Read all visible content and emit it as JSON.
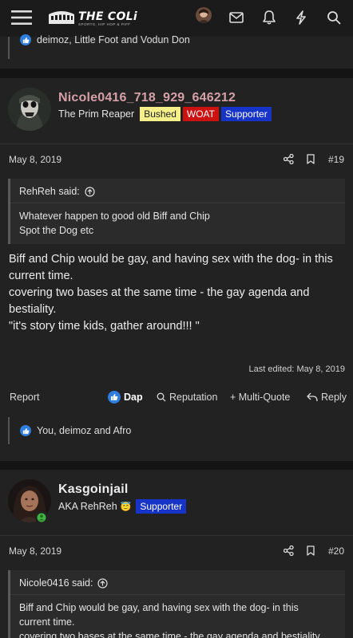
{
  "topbar": {
    "logo_text": "THE COLi",
    "logo_sub": "SPORTS, HIP HOP & PIFF",
    "icons": [
      "menu-icon",
      "avatar",
      "mail-icon",
      "bell-icon",
      "lightning-icon",
      "search-icon"
    ]
  },
  "top_reactions": {
    "text": "deimoz, Little Foot and Vodun Don"
  },
  "post19": {
    "username": "Nicole0416_718_929_646212",
    "user_title": "The Prim Reaper",
    "badges": [
      {
        "label": "Bushed",
        "bg": "#f5f08a",
        "fg": "#1a1a1a"
      },
      {
        "label": "WOAT",
        "bg": "#cc1111",
        "fg": "#ffffff"
      },
      {
        "label": "Supporter",
        "bg": "#1734c8",
        "fg": "#ffffff"
      }
    ],
    "date": "May 8, 2019",
    "post_number": "#19",
    "quote_author": "RehReh said:",
    "quote_lines": [
      "Whatever happen to good old Biff and Chip",
      "Spot the Dog etc"
    ],
    "message_lines": [
      "Biff and Chip would be gay, and having sex with the dog- in this",
      "current time.",
      "covering two bases at the same time - the gay agenda and",
      "bestiality.",
      "\"it's story time kids, gather around!!! \""
    ],
    "last_edited": "Last edited: May 8, 2019",
    "actions": {
      "report": "Report",
      "dap": "Dap",
      "reputation": "Reputation",
      "multi_quote": "+ Multi-Quote",
      "reply": "Reply"
    },
    "reactions": "You, deimoz and Afro"
  },
  "post20": {
    "username": "Kasgoinjail",
    "user_title": "AKA RehReh",
    "title_emoji": "😇",
    "badges": [
      {
        "label": "Supporter",
        "bg": "#1734c8",
        "fg": "#ffffff"
      }
    ],
    "date": "May 8, 2019",
    "post_number": "#20",
    "quote_author": "Nicole0416 said:",
    "quote_lines": [
      "Biff and Chip would be gay, and having sex with the dog- in this",
      "current time.",
      "covering two bases at the same time - the gay agenda and bestiality."
    ]
  },
  "colors": {
    "page_bg": "#141414",
    "card_bg": "#222222",
    "quote_bg": "#2b2b2b",
    "username_post19": "#d6a0a8",
    "accent_blue": "#2f7ddc",
    "online_green": "#3fb23f"
  }
}
